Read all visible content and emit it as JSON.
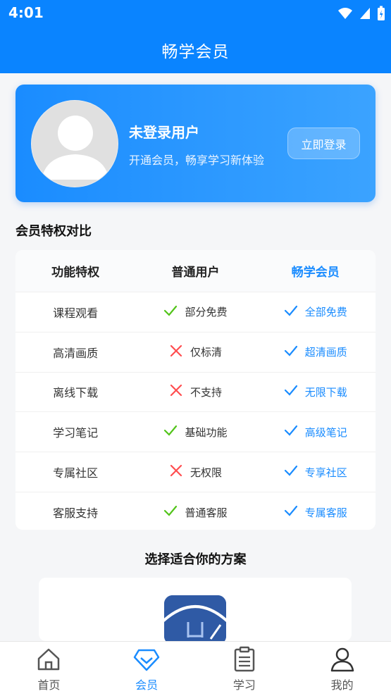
{
  "status": {
    "time": "4:01"
  },
  "header": {
    "title": "畅学会员"
  },
  "profile": {
    "name": "未登录用户",
    "subtitle": "开通会员，畅享学习新体验",
    "login_label": "立即登录"
  },
  "compare": {
    "section_title": "会员特权对比",
    "headers": [
      "功能特权",
      "普通用户",
      "畅学会员"
    ],
    "rows": [
      {
        "feature": "课程观看",
        "normal": "部分免费",
        "normal_ok": true,
        "vip": "全部免费"
      },
      {
        "feature": "高清画质",
        "normal": "仅标清",
        "normal_ok": false,
        "vip": "超清画质"
      },
      {
        "feature": "离线下载",
        "normal": "不支持",
        "normal_ok": false,
        "vip": "无限下载"
      },
      {
        "feature": "学习笔记",
        "normal": "基础功能",
        "normal_ok": true,
        "vip": "高级笔记"
      },
      {
        "feature": "专属社区",
        "normal": "无权限",
        "normal_ok": false,
        "vip": "专享社区"
      },
      {
        "feature": "客服支持",
        "normal": "普通客服",
        "normal_ok": true,
        "vip": "专属客服"
      }
    ]
  },
  "plans": {
    "title": "选择适合你的方案"
  },
  "nav": {
    "items": [
      {
        "label": "首页",
        "icon": "home-icon",
        "active": false
      },
      {
        "label": "会员",
        "icon": "diamond-icon",
        "active": true
      },
      {
        "label": "学习",
        "icon": "clipboard-icon",
        "active": false
      },
      {
        "label": "我的",
        "icon": "person-icon",
        "active": false
      }
    ]
  },
  "colors": {
    "primary": "#0a84ff",
    "vip": "#1a8cff",
    "ok": "#52c41a",
    "no": "#ff4d4f"
  }
}
